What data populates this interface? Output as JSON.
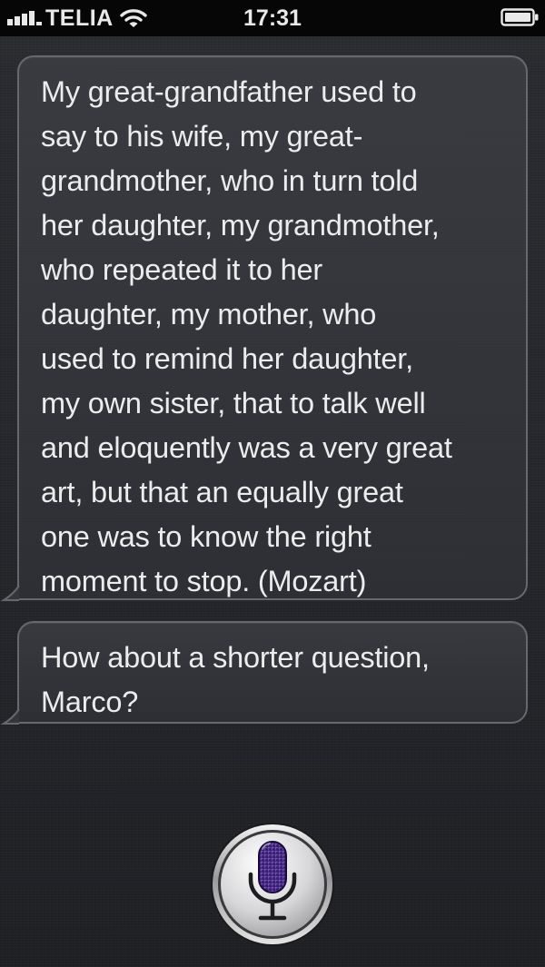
{
  "status_bar": {
    "carrier": "TELIA",
    "time": "17:31",
    "signal_icon": "signal-bars-icon",
    "wifi_icon": "wifi-icon",
    "battery_icon": "battery-icon"
  },
  "conversation": {
    "messages": [
      {
        "sender": "siri",
        "text": "My great-grandfather used to\nsay to his wife, my great-\ngrandmother, who in turn told\nher daughter, my grandmother,\nwho repeated it to her\ndaughter, my mother, who\nused to remind her daughter,\nmy own sister, that to talk well\nand eloquently was a very great\nart, but that an equally great\none was to know the right\nmoment to stop. (Mozart)"
      },
      {
        "sender": "siri",
        "text": "How about a shorter question,\nMarco?"
      }
    ]
  },
  "mic": {
    "icon": "microphone-icon"
  },
  "colors": {
    "background": "#26282d",
    "status_bar": "#060606",
    "bubble_border": "#66686e",
    "text": "#ececec",
    "mic_accent": "#5b3a9e"
  }
}
